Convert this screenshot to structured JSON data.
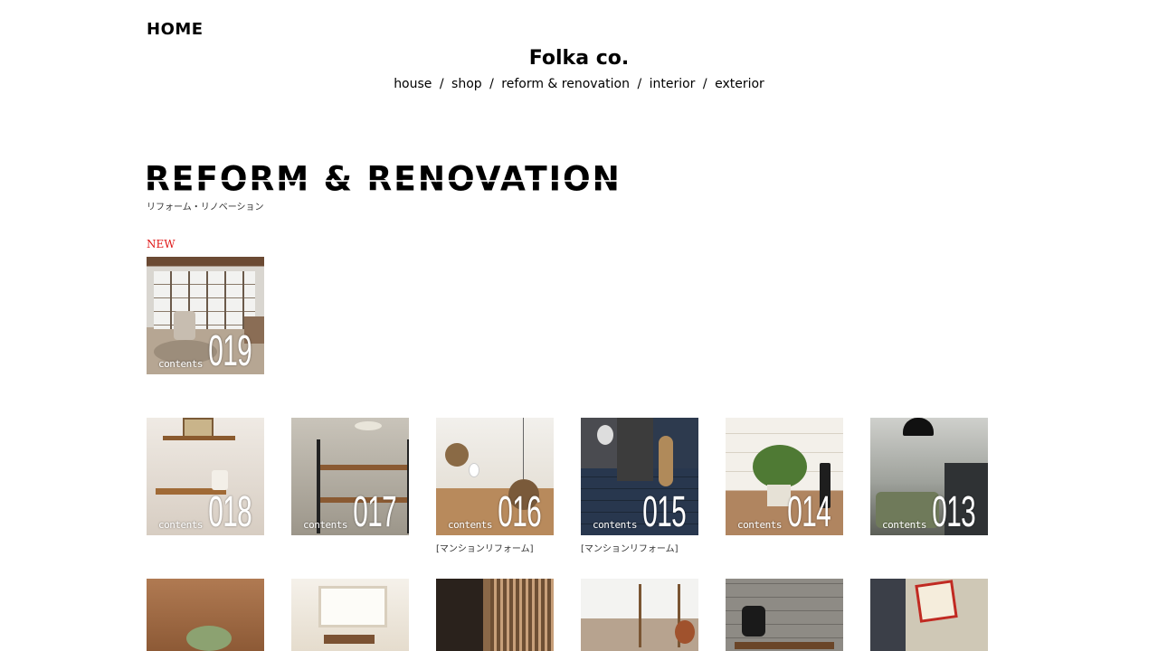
{
  "header": {
    "home_label": "HOME",
    "brand": "Folka co.",
    "nav": [
      "house",
      "shop",
      "reform & renovation",
      "interior",
      "exterior"
    ],
    "nav_separator": "/"
  },
  "section": {
    "title": "REFORM & RENOVATION",
    "subtitle": "リフォーム・リノベーション"
  },
  "new_badge": "NEW",
  "featured": {
    "small_label": "contents",
    "number": "019"
  },
  "grid": [
    {
      "small_label": "contents",
      "number": "018",
      "caption": ""
    },
    {
      "small_label": "contents",
      "number": "017",
      "caption": ""
    },
    {
      "small_label": "contents",
      "number": "016",
      "caption": "[マンションリフォーム]"
    },
    {
      "small_label": "contents",
      "number": "015",
      "caption": "[マンションリフォーム]"
    },
    {
      "small_label": "contents",
      "number": "014",
      "caption": ""
    },
    {
      "small_label": "contents",
      "number": "013",
      "caption": ""
    }
  ],
  "colors": {
    "new_badge": "#e01818",
    "text": "#000000",
    "background": "#ffffff"
  }
}
